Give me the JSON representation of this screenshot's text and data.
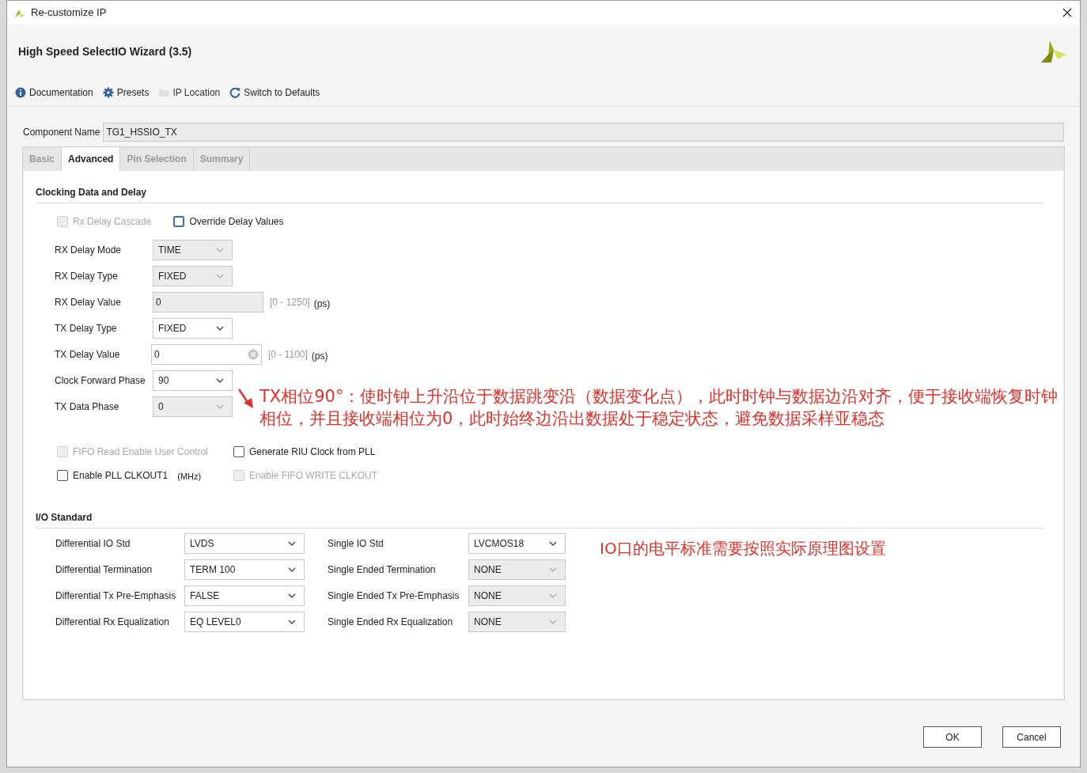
{
  "window": {
    "title": "Re-customize IP"
  },
  "header": {
    "title": "High Speed SelectIO Wizard (3.5)"
  },
  "toolbar": [
    {
      "label": "Documentation",
      "kind": "info",
      "disabled": false
    },
    {
      "label": "Presets",
      "kind": "gear",
      "disabled": false
    },
    {
      "label": "IP Location",
      "kind": "folder",
      "disabled": true
    },
    {
      "label": "Switch to Defaults",
      "kind": "refresh",
      "disabled": false
    }
  ],
  "component_name": {
    "label": "Component Name",
    "value": "TG1_HSSIO_TX"
  },
  "tabs": [
    {
      "label": "Basic",
      "selected": false
    },
    {
      "label": "Advanced",
      "selected": true
    },
    {
      "label": "Pin Selection",
      "selected": false
    },
    {
      "label": "Summary",
      "selected": false
    }
  ],
  "clocking": {
    "title": "Clocking Data and Delay",
    "checks": [
      {
        "label": "Rx Delay Cascade",
        "checked": false,
        "disabled": true,
        "focused": false
      },
      {
        "label": "Override Delay Values",
        "checked": false,
        "disabled": false,
        "focused": true
      }
    ],
    "fields": [
      {
        "label": "RX Delay Mode",
        "kind": "select",
        "value": "TIME",
        "disabled": true
      },
      {
        "label": "RX Delay Type",
        "kind": "select",
        "value": "FIXED",
        "disabled": true
      },
      {
        "label": "RX Delay Value",
        "kind": "text",
        "value": "0",
        "disabled": true,
        "range": "[0 - 1250]",
        "unit": "(ps)"
      },
      {
        "label": "TX Delay Type",
        "kind": "select",
        "value": "FIXED",
        "disabled": false
      },
      {
        "label": "TX Delay Value",
        "kind": "text",
        "value": "0",
        "disabled": false,
        "clearable": true,
        "range": "[0 - 1100]",
        "unit": "(ps)"
      },
      {
        "label": "Clock Forward Phase",
        "kind": "select",
        "value": "90",
        "disabled": false
      },
      {
        "label": "TX Data Phase",
        "kind": "select",
        "value": "0",
        "disabled": true
      }
    ],
    "options": [
      [
        {
          "label": "FIFO Read Enable User Control",
          "checked": false,
          "disabled": true
        },
        {
          "label": "Generate RIU Clock from PLL",
          "checked": false,
          "disabled": false
        }
      ],
      [
        {
          "label": "Enable PLL CLKOUT1",
          "checked": false,
          "disabled": false,
          "unit": "(MHz)"
        },
        {
          "label": "Enable FIFO WRITE CLKOUT",
          "checked": false,
          "disabled": true
        }
      ]
    ],
    "annotation": "TX相位90°：使时钟上升沿位于数据跳变沿（数据变化点），此时时钟与数据边沿对齐，便于接收端恢复时钟相位，并且接收端相位为0，此时始终边沿出数据处于稳定状态，避免数据采样亚稳态"
  },
  "io_standard": {
    "title": "I/O Standard",
    "left": [
      {
        "label": "Differential IO Std",
        "value": "LVDS",
        "disabled": false
      },
      {
        "label": "Differential Termination",
        "value": "TERM 100",
        "disabled": false
      },
      {
        "label": "Differential Tx Pre-Emphasis",
        "value": "FALSE",
        "disabled": false
      },
      {
        "label": "Differential Rx Equalization",
        "value": "EQ LEVEL0",
        "disabled": false
      }
    ],
    "right": [
      {
        "label": "Single IO Std",
        "value": "LVCMOS18",
        "disabled": false
      },
      {
        "label": "Single Ended Termination",
        "value": "NONE",
        "disabled": true
      },
      {
        "label": "Single Ended Tx Pre-Emphasis",
        "value": "NONE",
        "disabled": true
      },
      {
        "label": "Single Ended Rx Equalization",
        "value": "NONE",
        "disabled": true
      }
    ],
    "annotation": "IO口的电平标准需要按照实际原理图设置"
  },
  "buttons": [
    "OK",
    "Cancel"
  ]
}
